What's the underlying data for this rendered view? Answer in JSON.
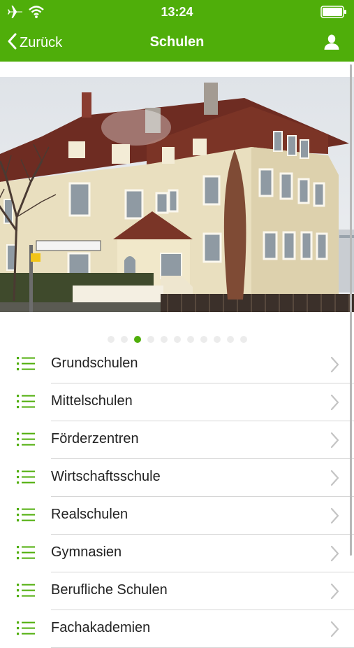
{
  "status_bar": {
    "time": "13:24"
  },
  "nav": {
    "back_label": "Zurück",
    "title": "Schulen"
  },
  "carousel": {
    "page_count": 11,
    "active_index": 2
  },
  "list": {
    "items": [
      {
        "label": "Grundschulen"
      },
      {
        "label": "Mittelschulen"
      },
      {
        "label": "Förderzentren"
      },
      {
        "label": "Wirtschaftsschule"
      },
      {
        "label": "Realschulen"
      },
      {
        "label": "Gymnasien"
      },
      {
        "label": "Berufliche Schulen"
      },
      {
        "label": "Fachakademien"
      }
    ]
  },
  "colors": {
    "accent": "#4fae0a",
    "separator": "#d6d6d6"
  }
}
